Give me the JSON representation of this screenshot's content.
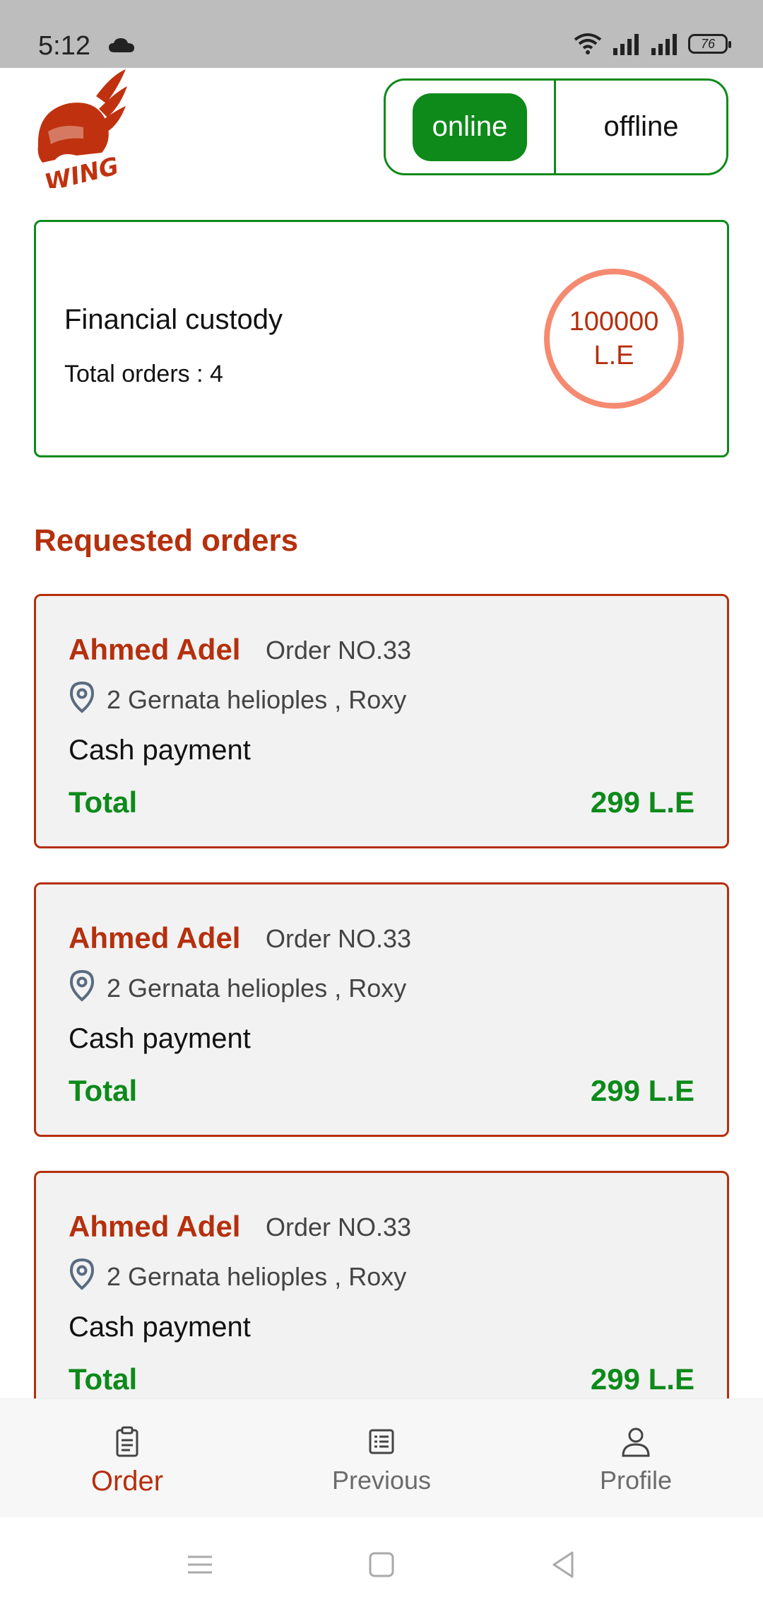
{
  "status_bar": {
    "time": "5:12",
    "battery": "76"
  },
  "logo": {
    "text": "WING"
  },
  "availability_toggle": {
    "online_label": "online",
    "offline_label": "offline",
    "selected": "online"
  },
  "financial": {
    "title": "Financial custody",
    "total_orders": "Total orders : 4",
    "amount_line1": "100000",
    "amount_line2": "L.E"
  },
  "section_title": "Requested orders",
  "orders": [
    {
      "name": "Ahmed Adel",
      "number": "Order NO.33",
      "address": "2 Gernata helioples , Roxy",
      "payment": "Cash payment",
      "total_label": "Total",
      "total_value": "299 L.E"
    },
    {
      "name": "Ahmed Adel",
      "number": "Order NO.33",
      "address": "2 Gernata helioples , Roxy",
      "payment": "Cash payment",
      "total_label": "Total",
      "total_value": "299 L.E"
    },
    {
      "name": "Ahmed Adel",
      "number": "Order NO.33",
      "address": "2 Gernata helioples , Roxy",
      "payment": "Cash payment",
      "total_label": "Total",
      "total_value": "299 L.E"
    }
  ],
  "bottom_nav": [
    {
      "label": "Order",
      "icon": "clipboard-icon",
      "active": true
    },
    {
      "label": "Previous",
      "icon": "list-icon",
      "active": false
    },
    {
      "label": "Profile",
      "icon": "person-icon",
      "active": false
    }
  ],
  "colors": {
    "brand_red": "#b5300d",
    "green": "#0d8a1a",
    "accent_circle": "#f58a70"
  }
}
